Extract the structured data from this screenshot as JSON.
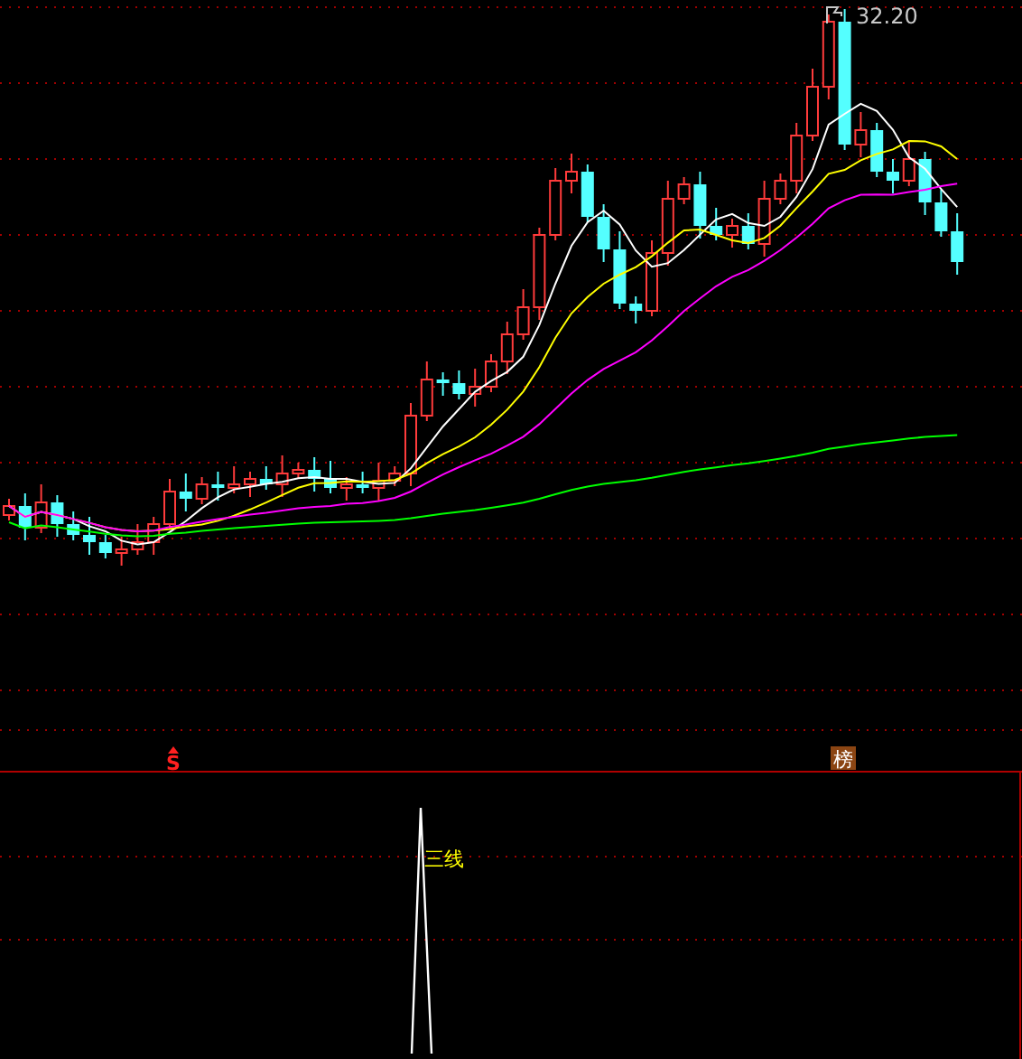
{
  "price_chart": {
    "high_label": "32.20",
    "signals": [
      {
        "kind": "buy",
        "label": "S"
      },
      {
        "kind": "rank",
        "label": "榜"
      }
    ]
  },
  "indicator": {
    "label": "三线"
  }
}
